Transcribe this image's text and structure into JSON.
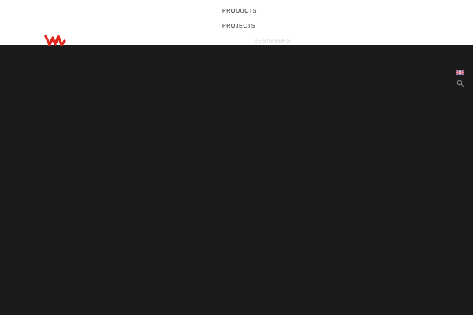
{
  "header": {
    "logo_icon": "brand-logo-icon",
    "brand_color": "#e2231a",
    "background": "#ffffff"
  },
  "nav": {
    "items": [
      {
        "label": "PRODUCTS"
      },
      {
        "label": "PROJECTS"
      },
      {
        "label": "DESIGNERS"
      }
    ]
  },
  "hero": {
    "background": "#1b1b1b"
  },
  "utility": {
    "language_icon": "uk-flag-icon",
    "search_icon": "search-icon"
  }
}
